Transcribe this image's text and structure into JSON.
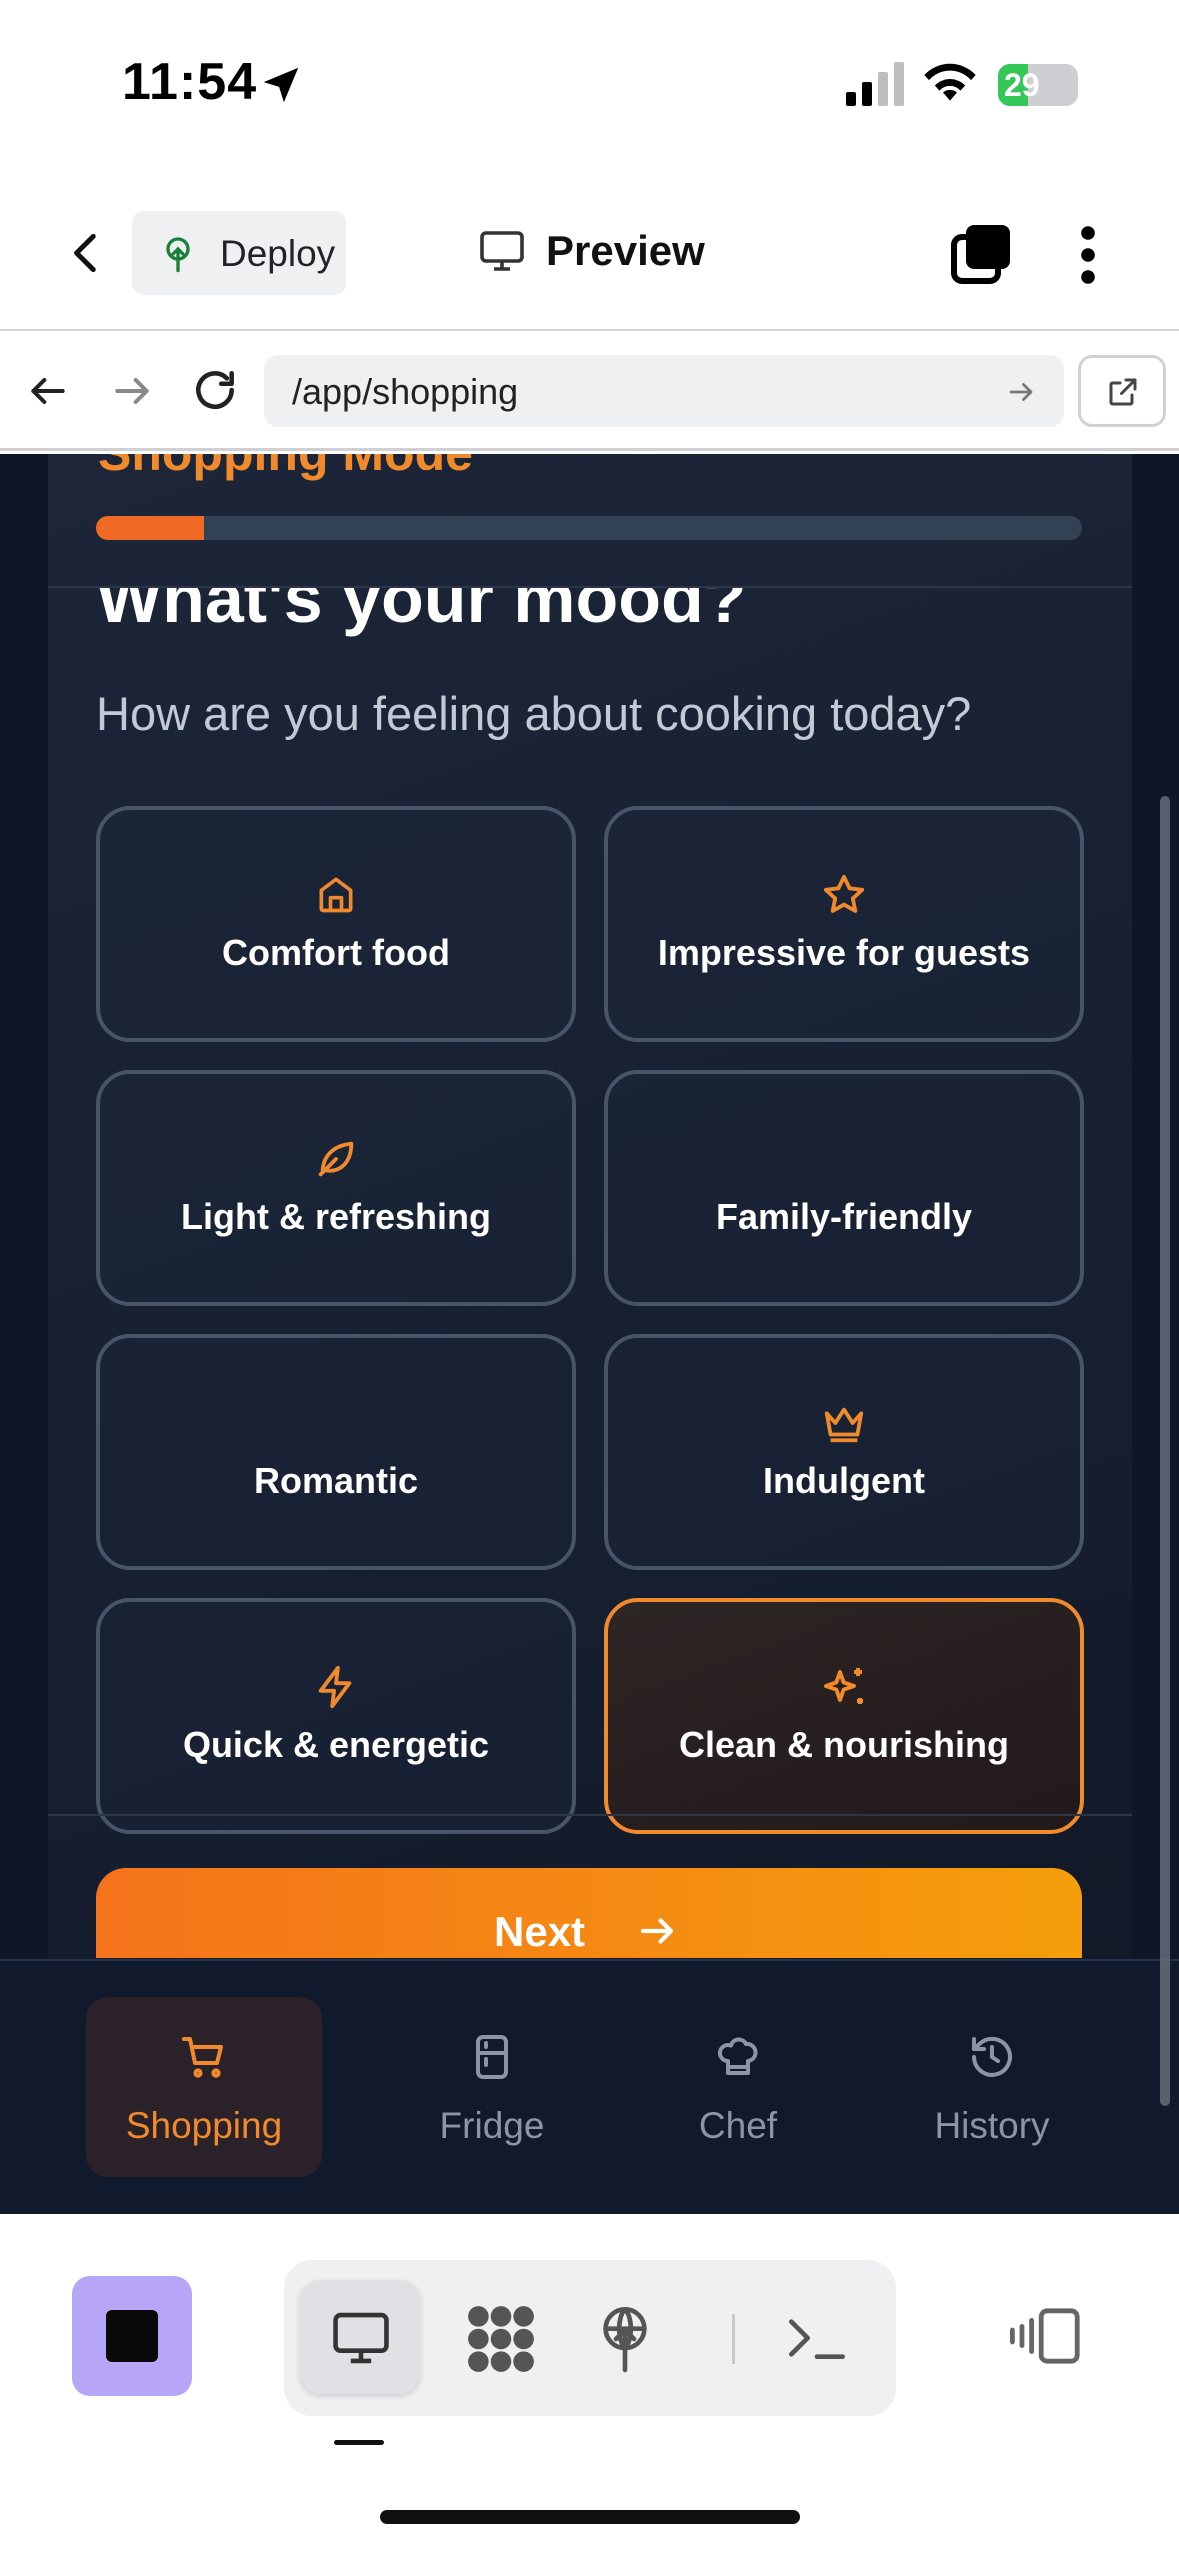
{
  "status_bar": {
    "time": "11:54",
    "battery": "29",
    "icons": [
      "location-arrow-icon",
      "signal-icon",
      "wifi-icon",
      "battery-icon"
    ]
  },
  "top_nav": {
    "deploy_label": "Deploy",
    "preview_label": "Preview",
    "icons": [
      "back-icon",
      "deploy-icon",
      "monitor-icon",
      "windows-icon",
      "more-icon"
    ]
  },
  "url_bar": {
    "url": "/app/shopping",
    "icons": [
      "arrow-left-icon",
      "arrow-right-icon",
      "reload-icon",
      "go-icon",
      "external-link-icon"
    ]
  },
  "wizard": {
    "mode_title": "Shopping Mode",
    "progress": 0.11,
    "question": "What's your mood?",
    "subtitle": "How are you feeling about cooking today?",
    "options": [
      {
        "label": "Comfort food",
        "icon": "home-icon",
        "selected": false
      },
      {
        "label": "Impressive for guests",
        "icon": "star-icon",
        "selected": false
      },
      {
        "label": "Light & refreshing",
        "icon": "leaf-icon",
        "selected": false
      },
      {
        "label": "Family-friendly",
        "icon": "",
        "selected": false
      },
      {
        "label": "Romantic",
        "icon": "",
        "selected": false
      },
      {
        "label": "Indulgent",
        "icon": "crown-icon",
        "selected": false
      },
      {
        "label": "Quick & energetic",
        "icon": "zap-icon",
        "selected": false
      },
      {
        "label": "Clean & nourishing",
        "icon": "sparkles-icon",
        "selected": true
      }
    ],
    "next_label": "Next"
  },
  "tabs": [
    {
      "label": "Shopping",
      "icon": "cart-icon",
      "active": true
    },
    {
      "label": "Fridge",
      "icon": "fridge-icon",
      "active": false
    },
    {
      "label": "Chef",
      "icon": "chef-hat-icon",
      "active": false
    },
    {
      "label": "History",
      "icon": "history-icon",
      "active": false
    }
  ],
  "toolbar": {
    "icons": [
      "stop-icon",
      "monitor-icon",
      "workspace-icon",
      "deploy-icon",
      "terminal-icon",
      "layout-icon"
    ]
  },
  "colors": {
    "accent": "#f08a2c",
    "app_bg": "#0e1628",
    "card_border": "#475569",
    "next_gradient_start": "#f5731b",
    "next_gradient_end": "#f59e0b",
    "stop_button": "#b7a6f7"
  }
}
